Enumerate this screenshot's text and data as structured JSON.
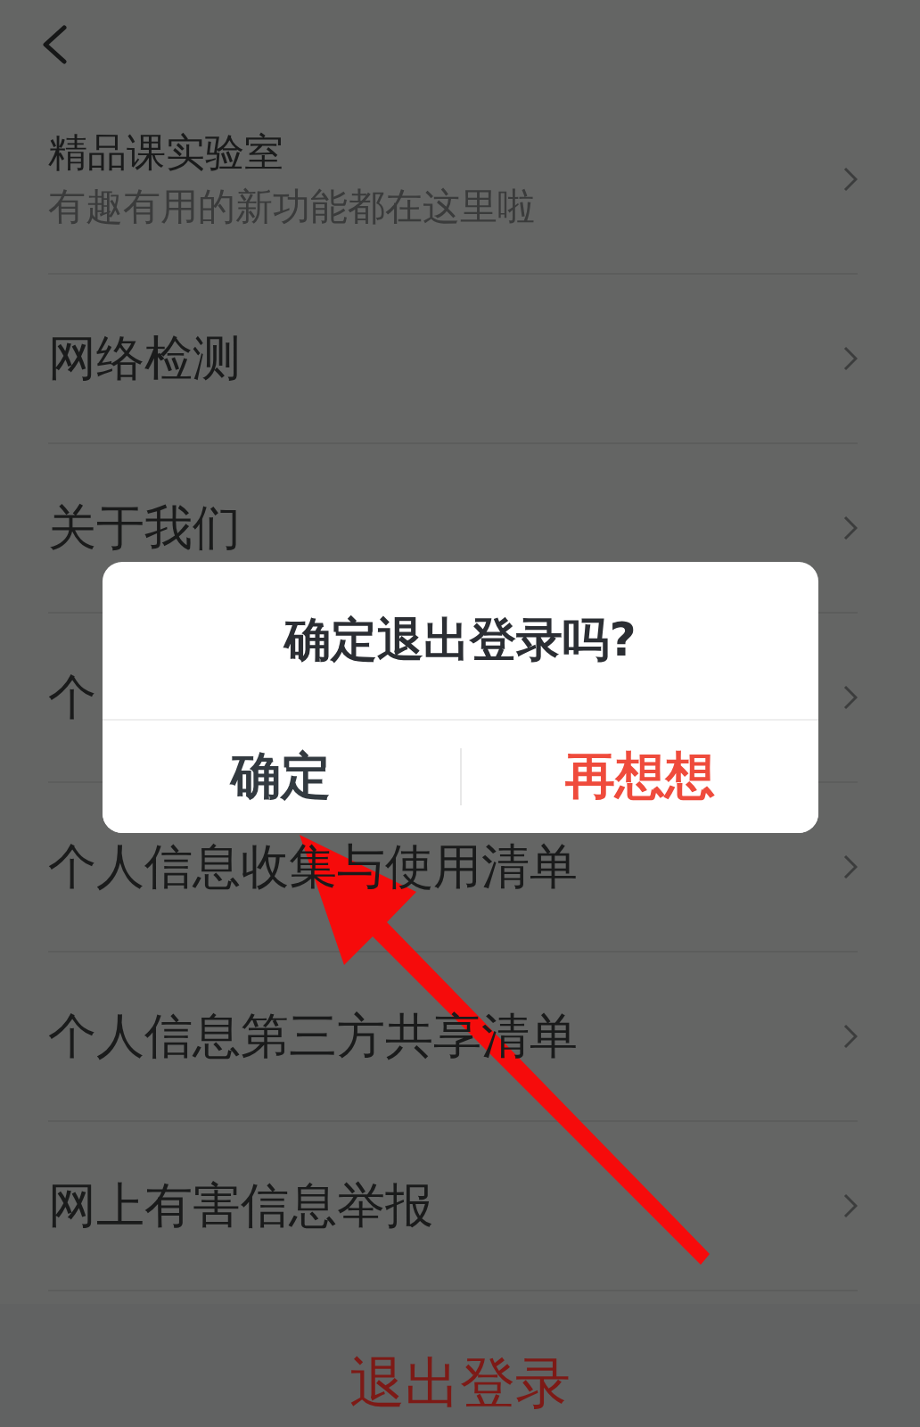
{
  "rows": [
    {
      "title": "精品课实验室",
      "subtitle": "有趣有用的新功能都在这里啦"
    },
    {
      "title": "网络检测"
    },
    {
      "title": "关于我们"
    },
    {
      "title": "个"
    },
    {
      "title": "个人信息收集与使用清单"
    },
    {
      "title": "个人信息第三方共享清单"
    },
    {
      "title": "网上有害信息举报"
    }
  ],
  "logout": {
    "label": "退出登录"
  },
  "dialog": {
    "title": "确定退出登录吗?",
    "buttons": [
      {
        "label": "确定",
        "kind": "confirm"
      },
      {
        "label": "再想想",
        "kind": "cancel"
      }
    ]
  }
}
